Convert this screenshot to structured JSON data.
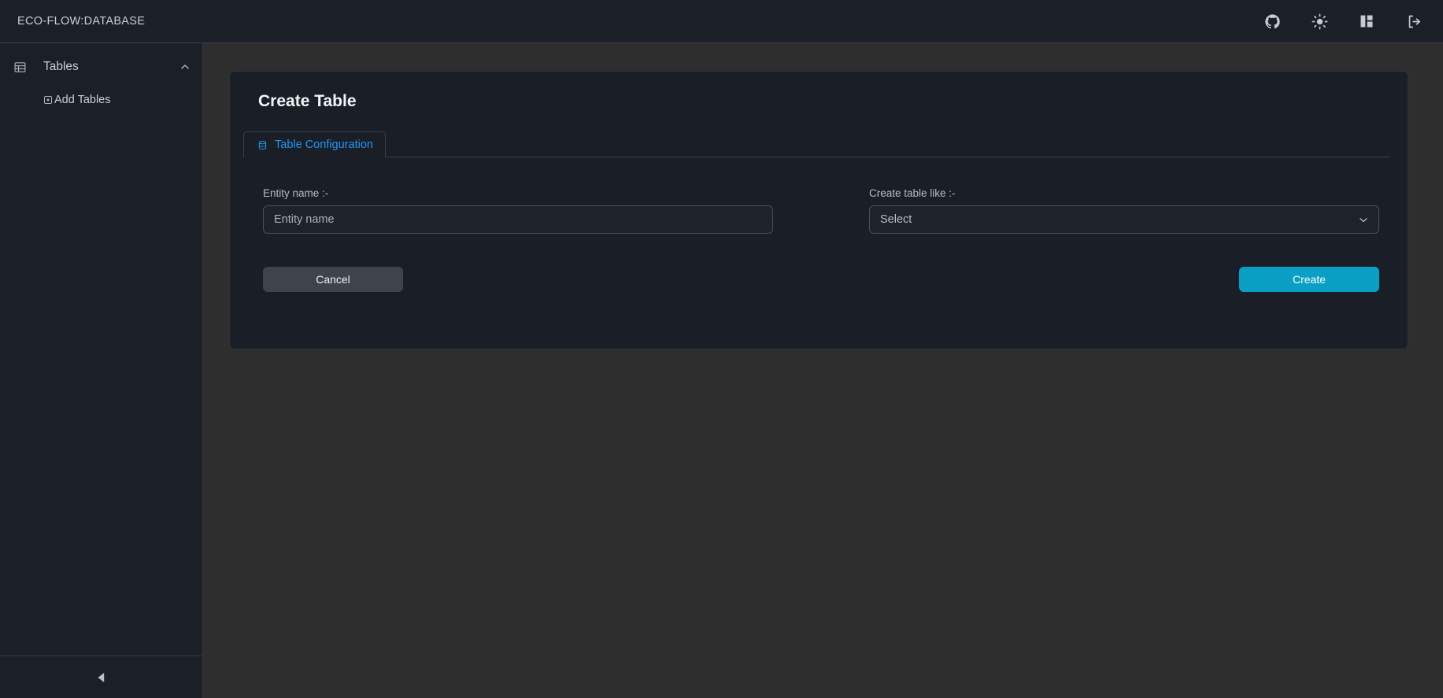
{
  "topbar": {
    "brand": "ECO-FLOW:DATABASE",
    "icons": [
      {
        "name": "github-icon",
        "label": "GitHub"
      },
      {
        "name": "sun-icon",
        "label": "Toggle theme"
      },
      {
        "name": "layout-panel-icon",
        "label": "Toggle panel"
      },
      {
        "name": "logout-icon",
        "label": "Log out"
      }
    ]
  },
  "sidebar": {
    "group": {
      "label": "Tables",
      "icon": "table-icon",
      "chevron": "chevron-up-icon",
      "expanded": true
    },
    "items": [
      {
        "label": "Add Tables",
        "icon": "square-plus-icon"
      }
    ],
    "collapse": {
      "icon": "caret-left-icon",
      "label": "Collapse sidebar"
    }
  },
  "card": {
    "title": "Create Table",
    "tabs": [
      {
        "label": "Table Configuration",
        "icon": "database-icon",
        "active": true
      }
    ],
    "fields": {
      "entity_name": {
        "label": "Entity name :-",
        "placeholder": "Entity name",
        "value": ""
      },
      "create_table_like": {
        "label": "Create table like :-",
        "selected": "Select",
        "chevron": "chevron-down-icon"
      }
    },
    "buttons": {
      "cancel": "Cancel",
      "create": "Create"
    }
  },
  "colors": {
    "accent": "#0a9fc4",
    "tab_active": "#2196f3",
    "panel_bg": "#1a1e26",
    "page_bg": "#2e2e2e",
    "chrome_bg": "#1b1f27"
  }
}
